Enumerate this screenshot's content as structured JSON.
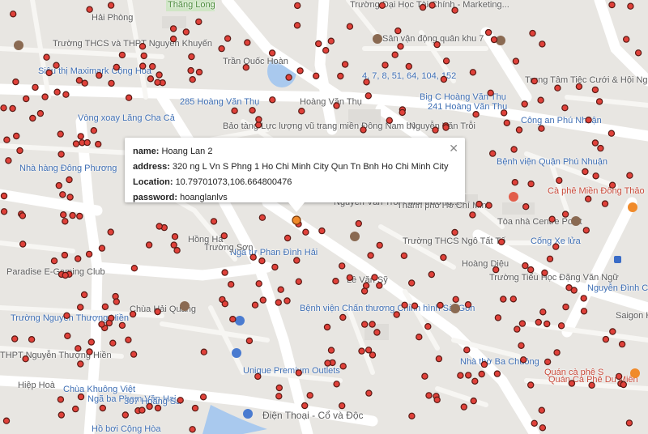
{
  "map": {
    "labels": [
      {
        "text": "Thăng Long",
        "cls": "green"
      },
      {
        "text": "Trần Quốc Hoàn",
        "cls": ""
      },
      {
        "text": "Trường Đại Học Tài Chính - Marketing...",
        "cls": ""
      },
      {
        "text": "Hải Phòng",
        "cls": ""
      },
      {
        "text": "Trường THCS và THPT Nguyễn Khuyến",
        "cls": ""
      },
      {
        "text": "Sân vận động quân khu 7",
        "cls": ""
      },
      {
        "text": "Siêu thị Maximark Cộng Hòa",
        "cls": "blue"
      },
      {
        "text": "4, 7, 8, 51, 64, 104, 152",
        "cls": "blue"
      },
      {
        "text": "Trung Tâm Tiệc Cưới & Hội Nghị White Palace",
        "cls": ""
      },
      {
        "text": "285 Hoàng Văn Thụ",
        "cls": "blue"
      },
      {
        "text": "Hoàng Văn Thụ",
        "cls": ""
      },
      {
        "text": "Big C Hoàng Văn Thụ",
        "cls": "blue"
      },
      {
        "text": "241 Hoàng Văn Thụ",
        "cls": "blue"
      },
      {
        "text": "Vòng xoay Lăng Cha Cả",
        "cls": "blue"
      },
      {
        "text": "Bảo tàng Lực lượng vũ trang miền Đông Nam bộ",
        "cls": ""
      },
      {
        "text": "Công an Phú Nhuận",
        "cls": "blue"
      },
      {
        "text": "Nhà hàng Đông Phương",
        "cls": "blue"
      },
      {
        "text": "Bệnh viện Quận Phú Nhuận",
        "cls": "blue"
      },
      {
        "text": "Cà phê Miền Đông Thảo",
        "cls": "red"
      },
      {
        "text": "Tòa nhà Centre Point",
        "cls": ""
      },
      {
        "text": "Thành phố Hồ Chí Minh",
        "cls": ""
      },
      {
        "text": "Nguyễn Văn Trỗi - Môi trường...",
        "cls": ""
      },
      {
        "text": "Trường THCS Ngô Tất Tố",
        "cls": ""
      },
      {
        "text": "Ngã tư Phan Đình Hải",
        "cls": "blue"
      },
      {
        "text": "Paradise E-Gaming Club",
        "cls": ""
      },
      {
        "text": "Chùa Hải Quang",
        "cls": ""
      },
      {
        "text": "Trường Nguyễn Thượng Hiền",
        "cls": "blue"
      },
      {
        "text": "Trường Tiểu Học Đặng Văn Ngữ",
        "cls": ""
      },
      {
        "text": "Saigon Hea...",
        "cls": ""
      },
      {
        "text": "Bệnh viện Chấn thương Chỉnh hình Sài Gòn",
        "cls": "blue"
      },
      {
        "text": "THPT Nguyễn Thượng Hiền",
        "cls": ""
      },
      {
        "text": "Unique Premium Outlets",
        "cls": "blue"
      },
      {
        "text": "Nhà thờ Ba Chuông",
        "cls": "blue"
      },
      {
        "text": "Quán cà phê S",
        "cls": "red"
      },
      {
        "text": "Chùa Khuông Việt",
        "cls": "blue"
      },
      {
        "text": "Ngã ba Phạm Văn Hai",
        "cls": "blue"
      },
      {
        "text": "Quán Cà Phê Du Miên",
        "cls": "red"
      },
      {
        "text": "Điện Thoại - Cổ và Độc",
        "cls": "big"
      },
      {
        "text": "307 Hoàng Sa",
        "cls": "blue"
      },
      {
        "text": "Hồ bơi Cộng Hòa",
        "cls": "blue"
      },
      {
        "text": "Trường Sơn",
        "cls": ""
      },
      {
        "text": "Nguyễn Văn Trỗi",
        "cls": ""
      },
      {
        "text": "Lê Văn Sỹ",
        "cls": ""
      },
      {
        "text": "Hoàng Diệu",
        "cls": ""
      },
      {
        "text": "Hồng Hà",
        "cls": ""
      },
      {
        "text": "Nguyễn Đình Chiểu",
        "cls": "blue"
      },
      {
        "text": "Cống Xe lửa",
        "cls": "blue"
      },
      {
        "text": "Hiệp Hoà",
        "cls": ""
      }
    ],
    "infowindow": {
      "name_label": "name:",
      "name": "Hoang Lan 2",
      "address_label": "address:",
      "address": "320 ng L Vn S Phng 1 Ho Chi Minh City Qun Tn Bnh Ho Chi Minh City",
      "location_label": "Location:",
      "location": "10.79701073,106.664800476",
      "password_label": "password:",
      "password": "hoanglanlvs",
      "close_icon": "close-icon"
    },
    "colors": {
      "marker": "#e0413a",
      "marker_outline": "#5a1a14",
      "road_major": "#ffffff",
      "road_minor": "#f7f6f3",
      "water": "#a9c9ee",
      "park": "#cfe6c5",
      "block": "#e6e4e0"
    }
  }
}
